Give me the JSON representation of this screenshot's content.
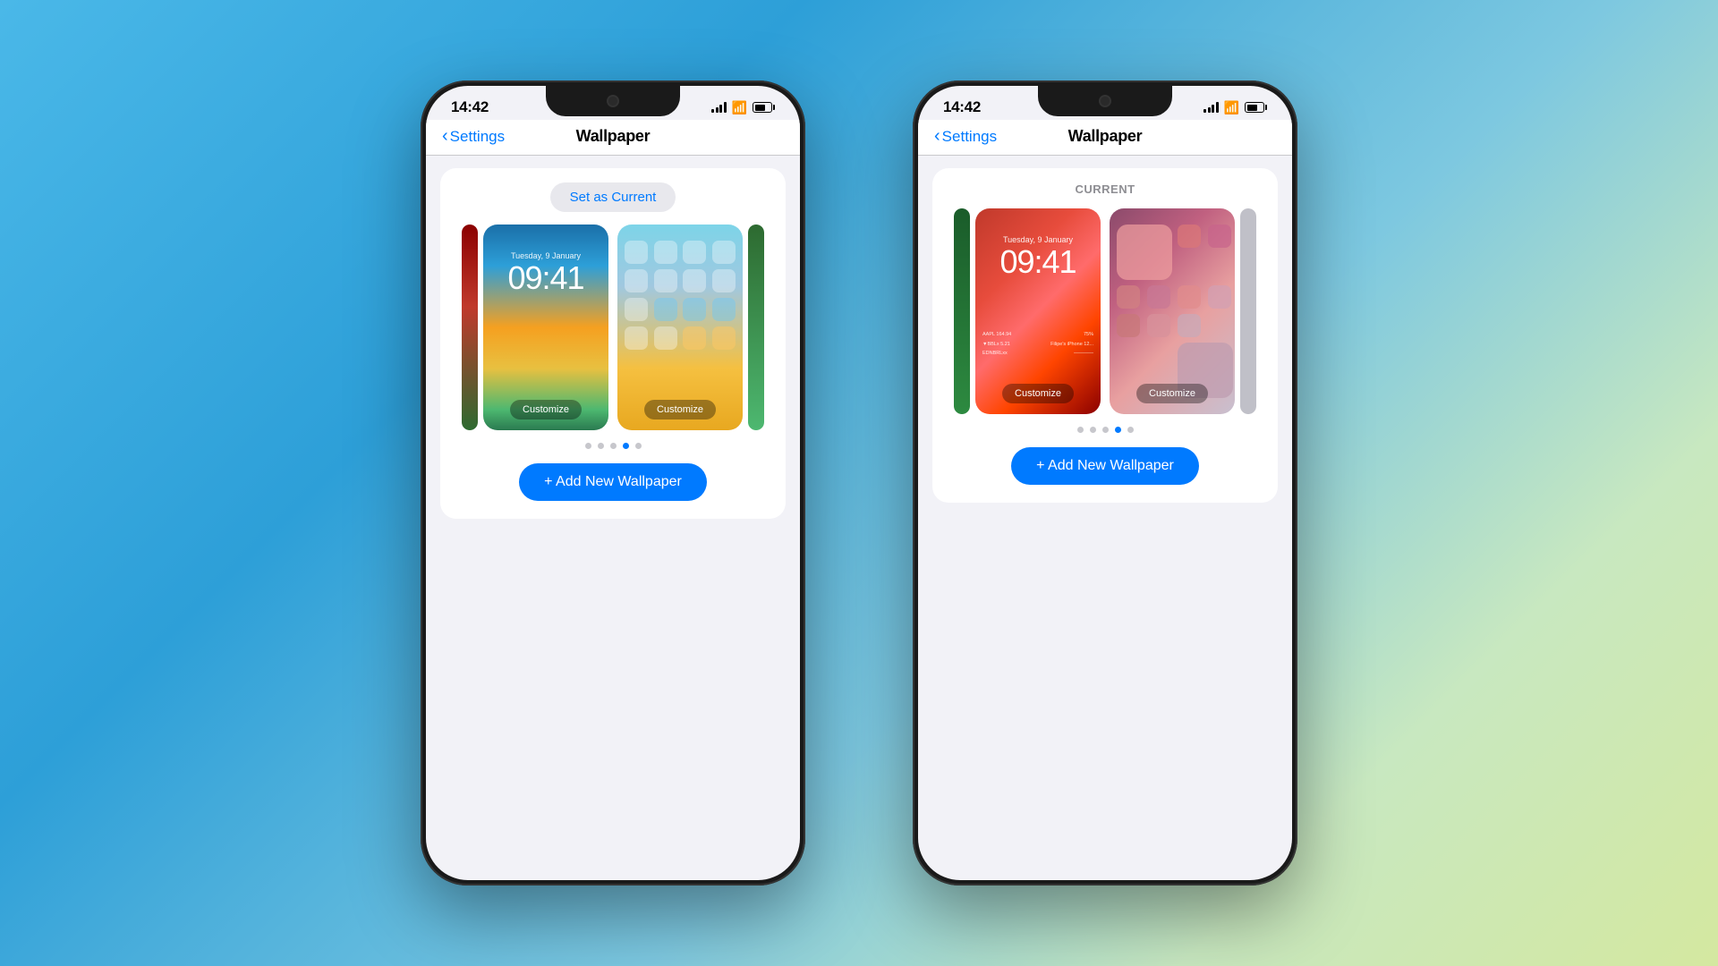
{
  "background": {
    "gradient": "blue-to-green"
  },
  "phone1": {
    "status_bar": {
      "time": "14:42",
      "battery_level": "40"
    },
    "nav": {
      "back_label": "Settings",
      "title": "Wallpaper"
    },
    "card": {
      "set_as_current_label": "Set as Current",
      "dots_count": 5,
      "active_dot": 3,
      "add_button_label": "+ Add New Wallpaper"
    },
    "lock_screen": {
      "date": "Tuesday, 9 January",
      "time": "09:41",
      "customize_label": "Customize"
    },
    "home_screen": {
      "customize_label": "Customize"
    }
  },
  "phone2": {
    "status_bar": {
      "time": "14:42",
      "battery_level": "40"
    },
    "nav": {
      "back_label": "Settings",
      "title": "Wallpaper"
    },
    "card": {
      "current_label": "CURRENT",
      "dots_count": 5,
      "active_dot": 3,
      "add_button_label": "+ Add New Wallpaper"
    },
    "lock_screen": {
      "date": "Tuesday, 9 January",
      "time": "09:41",
      "customize_label": "Customize"
    },
    "home_screen": {
      "customize_label": "Customize"
    }
  }
}
